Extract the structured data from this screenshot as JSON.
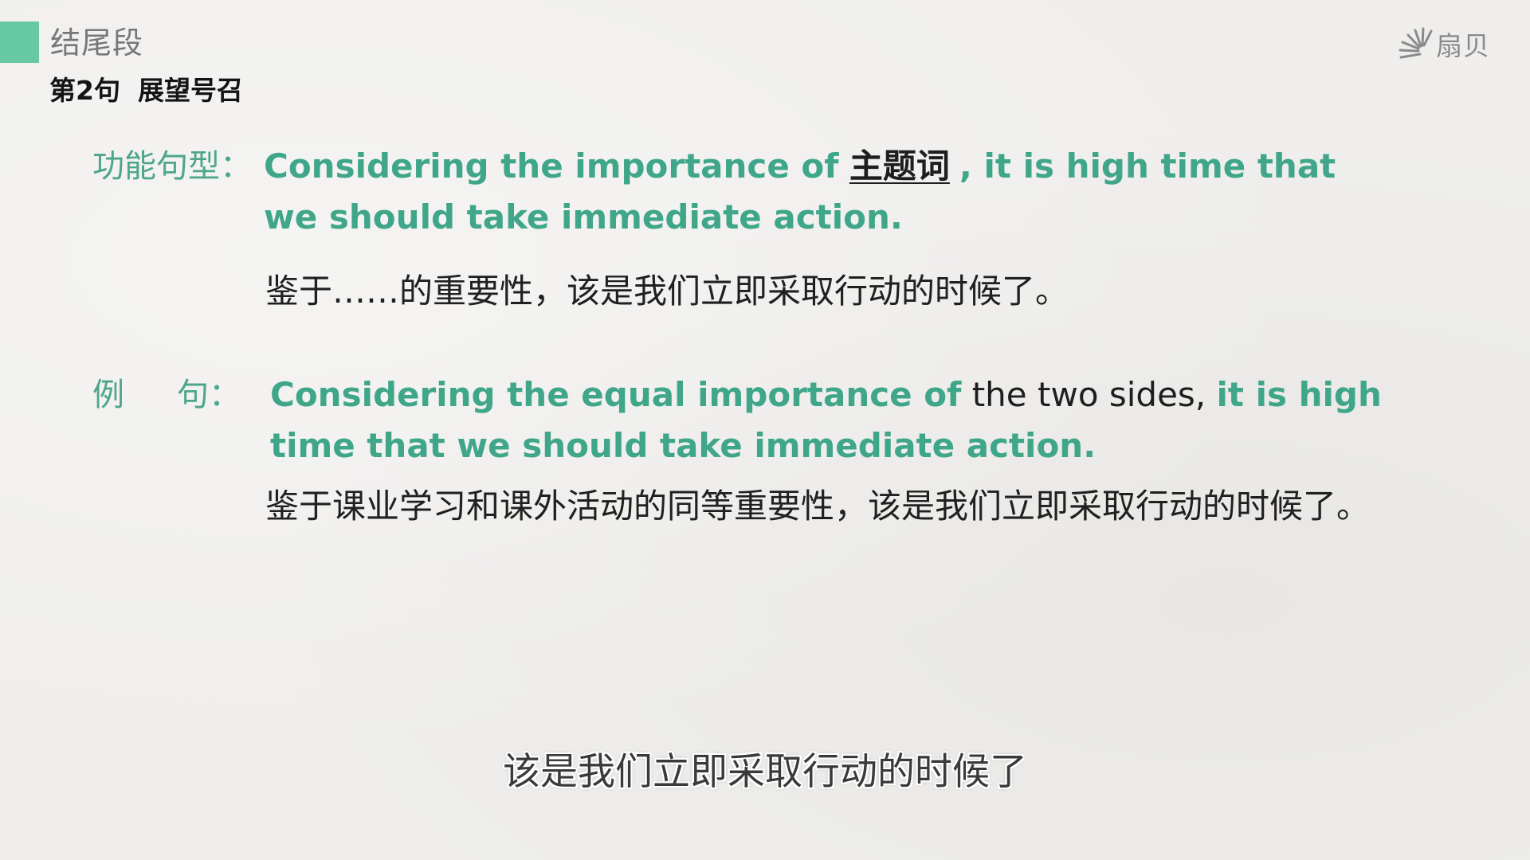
{
  "header": {
    "section_title": "结尾段",
    "sentence_number": "第2句",
    "sentence_topic": "展望号召"
  },
  "logo": {
    "icon": "sunburst-logo-icon",
    "text": "扇贝"
  },
  "pattern": {
    "label": "功能句型：",
    "en_part1": "Considering the importance of",
    "blank_word": "主题词",
    "en_part2": ", it is high time that we should take immediate action.",
    "zh": "鉴于……的重要性，该是我们立即采取行动的时候了。"
  },
  "example": {
    "label_char1": "例",
    "label_char2": "句：",
    "en_part1": "Considering the equal importance of",
    "en_plain": "the two sides,",
    "en_part2": "it is high time that we should take immediate action.",
    "zh": "鉴于课业学习和课外活动的同等重要性，该是我们立即采取行动的时候了。"
  },
  "subtitle": "该是我们立即采取行动的时候了",
  "colors": {
    "accent_green": "#3fa68a",
    "tag_green": "#67c9a3",
    "background": "#efeeec"
  }
}
